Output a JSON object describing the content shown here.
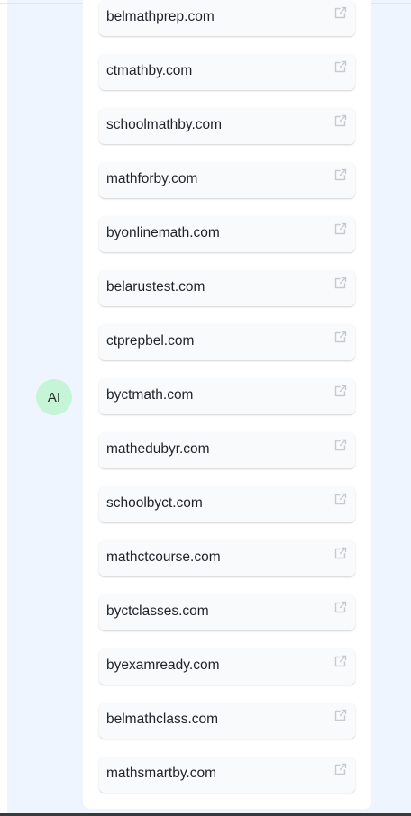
{
  "avatar": {
    "label": "AI"
  },
  "links": [
    {
      "label": "belmathprep.com",
      "icon": "external-link-icon"
    },
    {
      "label": "ctmathby.com",
      "icon": "external-link-icon"
    },
    {
      "label": "schoolmathby.com",
      "icon": "external-link-icon"
    },
    {
      "label": "mathforby.com",
      "icon": "external-link-icon"
    },
    {
      "label": "byonlinemath.com",
      "icon": "external-link-icon"
    },
    {
      "label": "belarustest.com",
      "icon": "external-link-icon"
    },
    {
      "label": "ctprepbel.com",
      "icon": "external-link-icon"
    },
    {
      "label": "byctmath.com",
      "icon": "external-link-icon"
    },
    {
      "label": "mathedubyr.com",
      "icon": "external-link-icon"
    },
    {
      "label": "schoolbyct.com",
      "icon": "external-link-icon"
    },
    {
      "label": "mathctcourse.com",
      "icon": "external-link-icon"
    },
    {
      "label": "byctclasses.com",
      "icon": "external-link-icon"
    },
    {
      "label": "byexamready.com",
      "icon": "external-link-icon"
    },
    {
      "label": "belmathclass.com",
      "icon": "external-link-icon"
    },
    {
      "label": "mathsmartby.com",
      "icon": "external-link-icon"
    }
  ],
  "colors": {
    "panel_bg": "#eff5ff",
    "avatar_bg": "#c5f5d6",
    "card_bg": "#ffffff",
    "link_bg": "#f9fafb",
    "icon_color": "#c7cbd1"
  }
}
